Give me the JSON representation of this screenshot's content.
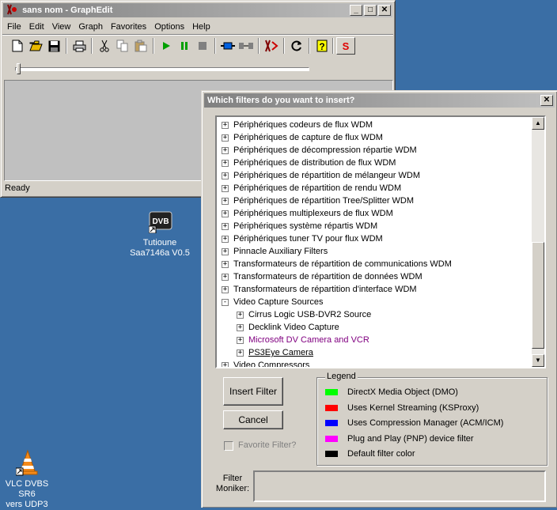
{
  "graphedit": {
    "title": "sans nom - GraphEdit",
    "menu": [
      "File",
      "Edit",
      "View",
      "Graph",
      "Favorites",
      "Options",
      "Help"
    ],
    "status": "Ready"
  },
  "desktop": {
    "icon1": {
      "line1": "Tutioune",
      "line2": "Saa7146a V0.5"
    },
    "icon2": {
      "line1": "VLC DVBS SR6",
      "line2": "vers UDP3"
    }
  },
  "dialog": {
    "title": "Which filters do you want to insert?",
    "insert_label": "Insert Filter",
    "cancel_label": "Cancel",
    "favorite_label": "Favorite Filter?",
    "legend_title": "Legend",
    "moniker_label_1": "Filter",
    "moniker_label_2": "Moniker:",
    "tree": [
      {
        "label": "Périphériques codeurs de flux WDM",
        "level": 0,
        "sign": "+"
      },
      {
        "label": "Périphériques de capture de flux WDM",
        "level": 0,
        "sign": "+"
      },
      {
        "label": "Périphériques de décompression répartie WDM",
        "level": 0,
        "sign": "+"
      },
      {
        "label": "Périphériques de distribution de flux WDM",
        "level": 0,
        "sign": "+"
      },
      {
        "label": "Périphériques de répartition de mélangeur WDM",
        "level": 0,
        "sign": "+"
      },
      {
        "label": "Périphériques de répartition de rendu WDM",
        "level": 0,
        "sign": "+"
      },
      {
        "label": "Périphériques de répartition Tree/Splitter WDM",
        "level": 0,
        "sign": "+"
      },
      {
        "label": "Périphériques multiplexeurs de flux WDM",
        "level": 0,
        "sign": "+"
      },
      {
        "label": "Périphériques système répartis WDM",
        "level": 0,
        "sign": "+"
      },
      {
        "label": "Périphériques tuner TV pour flux WDM",
        "level": 0,
        "sign": "+"
      },
      {
        "label": "Pinnacle Auxiliary Filters",
        "level": 0,
        "sign": "+"
      },
      {
        "label": "Transformateurs de répartition de communications WDM",
        "level": 0,
        "sign": "+"
      },
      {
        "label": "Transformateurs de répartition de données WDM",
        "level": 0,
        "sign": "+"
      },
      {
        "label": "Transformateurs de répartition d'interface WDM",
        "level": 0,
        "sign": "+"
      },
      {
        "label": "Video Capture Sources",
        "level": 0,
        "sign": "-"
      },
      {
        "label": "Cirrus Logic USB-DVR2 Source",
        "level": 1,
        "sign": "+"
      },
      {
        "label": "Decklink Video Capture",
        "level": 1,
        "sign": "+"
      },
      {
        "label": "Microsoft DV Camera and VCR",
        "level": 1,
        "sign": "+",
        "color": "#800080"
      },
      {
        "label": "PS3Eye Camera",
        "level": 1,
        "sign": "+",
        "underline": true
      },
      {
        "label": "Video Compressors",
        "level": 0,
        "sign": "+"
      }
    ],
    "legend": [
      {
        "label": "DirectX Media Object (DMO)",
        "color": "#00ff00"
      },
      {
        "label": "Uses Kernel Streaming (KSProxy)",
        "color": "#ff0000"
      },
      {
        "label": "Uses Compression Manager (ACM/ICM)",
        "color": "#0000ff"
      },
      {
        "label": "Plug and Play (PNP) device filter",
        "color": "#ff00ff"
      },
      {
        "label": "Default filter color",
        "color": "#000000"
      }
    ]
  }
}
